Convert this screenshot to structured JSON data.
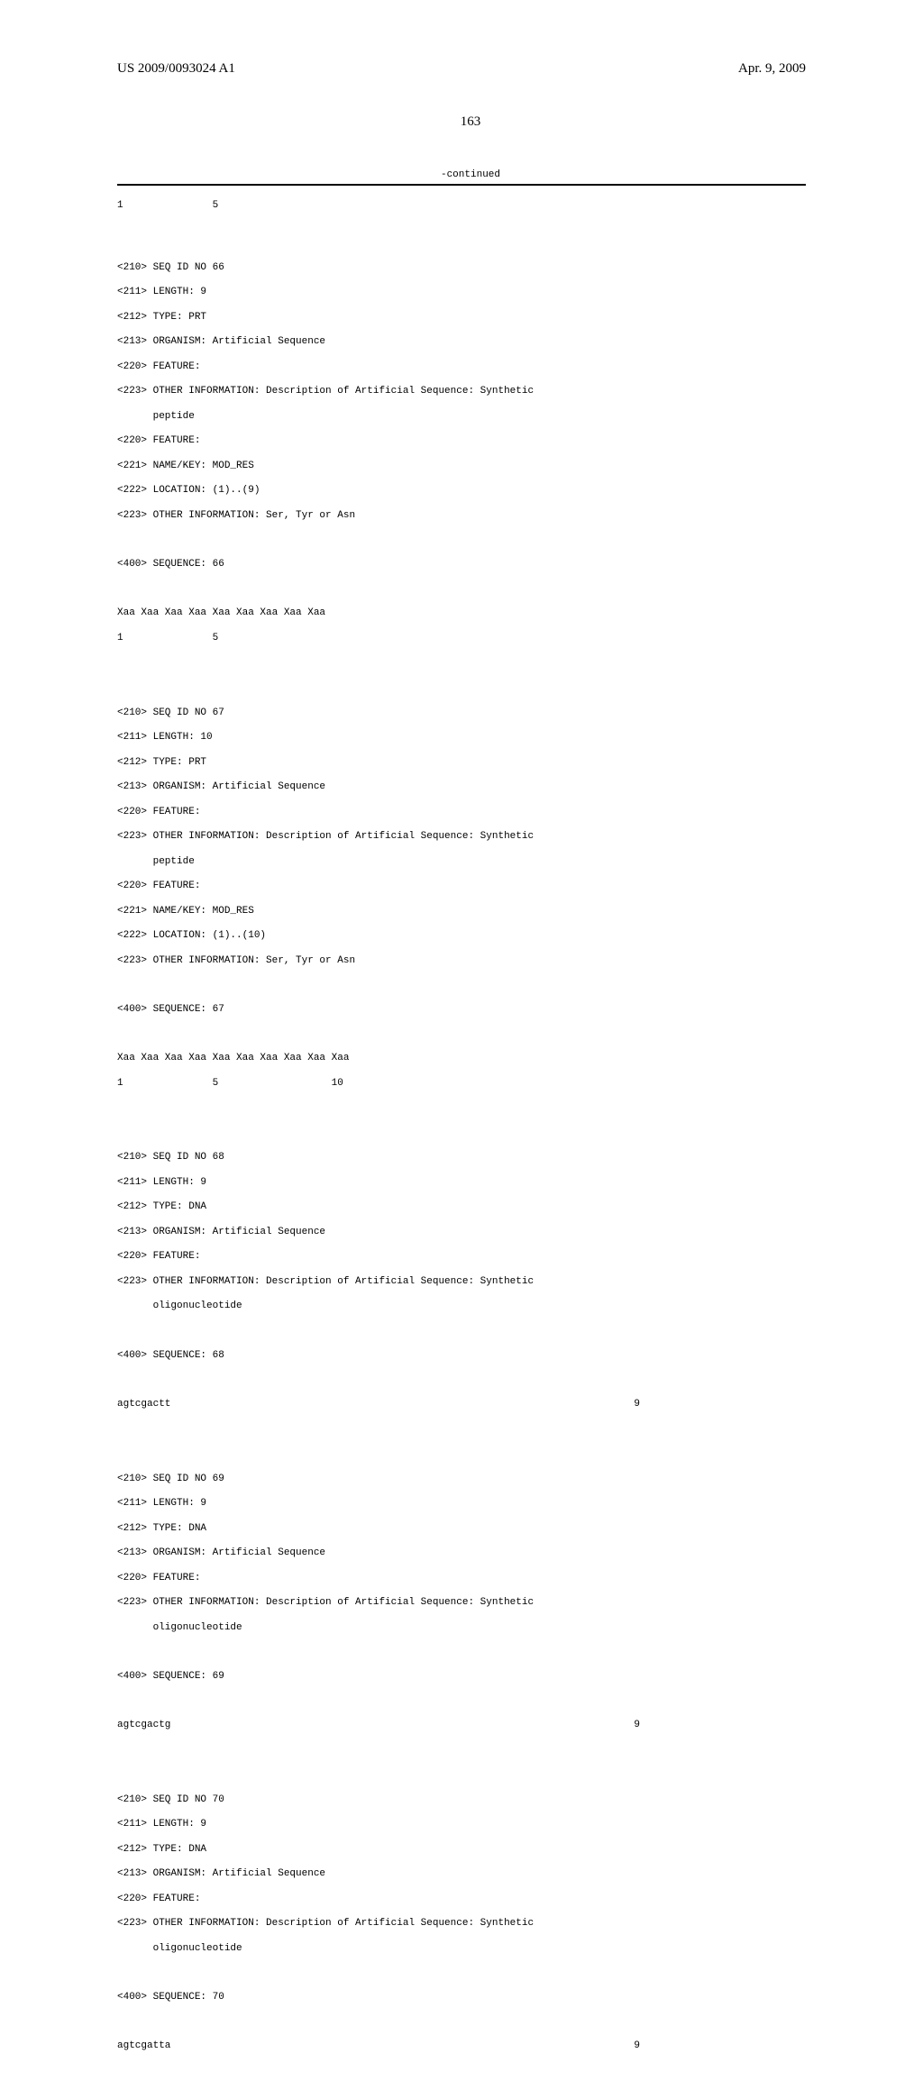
{
  "header": {
    "left": "US 2009/0093024 A1",
    "right": "Apr. 9, 2009"
  },
  "page_number": "163",
  "continued_label": "-continued",
  "top_residual_line": "1               5",
  "seq66": {
    "l1": "<210> SEQ ID NO 66",
    "l2": "<211> LENGTH: 9",
    "l3": "<212> TYPE: PRT",
    "l4": "<213> ORGANISM: Artificial Sequence",
    "l5": "<220> FEATURE:",
    "l6": "<223> OTHER INFORMATION: Description of Artificial Sequence: Synthetic",
    "l7": "      peptide",
    "l8": "<220> FEATURE:",
    "l9": "<221> NAME/KEY: MOD_RES",
    "l10": "<222> LOCATION: (1)..(9)",
    "l11": "<223> OTHER INFORMATION: Ser, Tyr or Asn",
    "s1": "<400> SEQUENCE: 66",
    "seq": "Xaa Xaa Xaa Xaa Xaa Xaa Xaa Xaa Xaa",
    "pos": "1               5"
  },
  "seq67": {
    "l1": "<210> SEQ ID NO 67",
    "l2": "<211> LENGTH: 10",
    "l3": "<212> TYPE: PRT",
    "l4": "<213> ORGANISM: Artificial Sequence",
    "l5": "<220> FEATURE:",
    "l6": "<223> OTHER INFORMATION: Description of Artificial Sequence: Synthetic",
    "l7": "      peptide",
    "l8": "<220> FEATURE:",
    "l9": "<221> NAME/KEY: MOD_RES",
    "l10": "<222> LOCATION: (1)..(10)",
    "l11": "<223> OTHER INFORMATION: Ser, Tyr or Asn",
    "s1": "<400> SEQUENCE: 67",
    "seq": "Xaa Xaa Xaa Xaa Xaa Xaa Xaa Xaa Xaa Xaa",
    "pos": "1               5                   10"
  },
  "seq68": {
    "l1": "<210> SEQ ID NO 68",
    "l2": "<211> LENGTH: 9",
    "l3": "<212> TYPE: DNA",
    "l4": "<213> ORGANISM: Artificial Sequence",
    "l5": "<220> FEATURE:",
    "l6": "<223> OTHER INFORMATION: Description of Artificial Sequence: Synthetic",
    "l7": "      oligonucleotide",
    "s1": "<400> SEQUENCE: 68",
    "seq": "agtcgactt",
    "len": "9"
  },
  "seq69": {
    "l1": "<210> SEQ ID NO 69",
    "l2": "<211> LENGTH: 9",
    "l3": "<212> TYPE: DNA",
    "l4": "<213> ORGANISM: Artificial Sequence",
    "l5": "<220> FEATURE:",
    "l6": "<223> OTHER INFORMATION: Description of Artificial Sequence: Synthetic",
    "l7": "      oligonucleotide",
    "s1": "<400> SEQUENCE: 69",
    "seq": "agtcgactg",
    "len": "9"
  },
  "seq70": {
    "l1": "<210> SEQ ID NO 70",
    "l2": "<211> LENGTH: 9",
    "l3": "<212> TYPE: DNA",
    "l4": "<213> ORGANISM: Artificial Sequence",
    "l5": "<220> FEATURE:",
    "l6": "<223> OTHER INFORMATION: Description of Artificial Sequence: Synthetic",
    "l7": "      oligonucleotide",
    "s1": "<400> SEQUENCE: 70",
    "seq": "agtcgatta",
    "len": "9"
  }
}
